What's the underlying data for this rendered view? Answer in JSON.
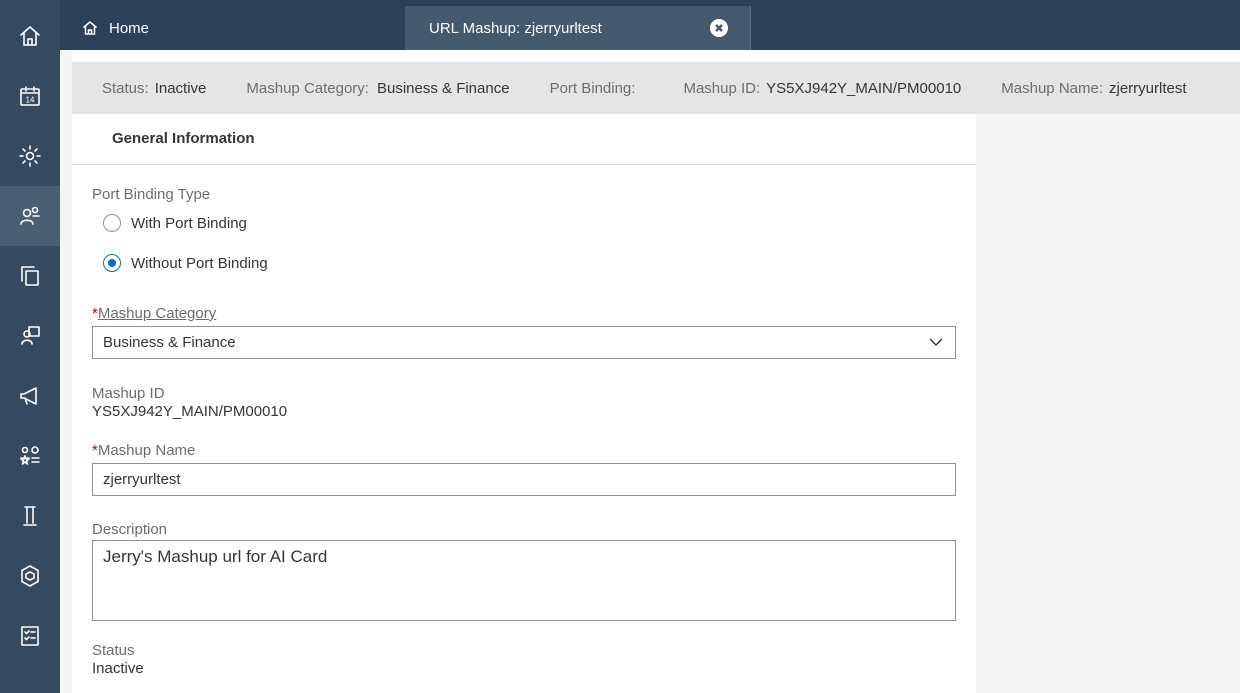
{
  "tabs": {
    "home_label": "Home",
    "active_label": "URL Mashup: zjerryurltest"
  },
  "header": {
    "status_key": "Status:",
    "status_val": "Inactive",
    "category_key": "Mashup Category:",
    "category_val": "Business & Finance",
    "port_key": "Port Binding:",
    "port_val": "",
    "id_key": "Mashup ID:",
    "id_val": "YS5XJ942Y_MAIN/PM00010",
    "name_key": "Mashup Name:",
    "name_val": "zjerryurltest"
  },
  "section": {
    "title": "General Information"
  },
  "form": {
    "port_binding_type_label": "Port Binding Type",
    "radio_with": "With Port Binding",
    "radio_without": "Without Port Binding",
    "radio_selected": "Without Port Binding",
    "required_mark": "*",
    "category_label": "Mashup Category",
    "category_value": "Business & Finance",
    "id_label": "Mashup ID",
    "id_value": "YS5XJ942Y_MAIN/PM00010",
    "name_label": "Mashup Name",
    "name_value": "zjerryurltest",
    "description_label": "Description",
    "description_value": "Jerry's Mashup url for AI Card",
    "status_label": "Status",
    "status_value": "Inactive"
  },
  "rail": {
    "icons": [
      "home-icon",
      "calendar-icon",
      "settings-icon",
      "user-group-icon",
      "copy-icon",
      "people-icon",
      "megaphone-icon",
      "ranking-icon",
      "tower-icon",
      "package-icon",
      "checklist-icon"
    ],
    "calendar_day": "14"
  },
  "colors": {
    "rail_bg": "#354a5f",
    "topbar_bg": "#2c4158",
    "active_tab_bg": "#45596c",
    "required": "#bb0000",
    "accent": "#0a6ed1"
  }
}
